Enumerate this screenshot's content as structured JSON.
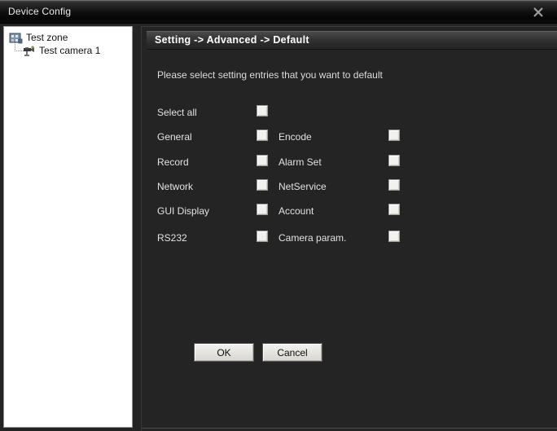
{
  "window": {
    "title": "Device Config",
    "close_icon": "close-x-icon"
  },
  "tree": {
    "nodes": [
      {
        "label": "Test zone",
        "icon": "zone-folder-icon"
      },
      {
        "label": "Test camera 1",
        "icon": "camera-icon"
      }
    ]
  },
  "content": {
    "section_header": "Setting -> Advanced -> Default",
    "instruction": "Please select setting entries that you want to default"
  },
  "rows": [
    {
      "col1_label": "Select all",
      "col1_checked": false,
      "col2_label": "",
      "col2_checked": null
    },
    {
      "col1_label": "General",
      "col1_checked": false,
      "col2_label": "Encode",
      "col2_checked": false
    },
    {
      "col1_label": "Record",
      "col1_checked": false,
      "col2_label": "Alarm Set",
      "col2_checked": false
    },
    {
      "col1_label": "Network",
      "col1_checked": false,
      "col2_label": "NetService",
      "col2_checked": false
    },
    {
      "col1_label": "GUI Display",
      "col1_checked": false,
      "col2_label": "Account",
      "col2_checked": false
    },
    {
      "col1_label": "RS232",
      "col1_checked": false,
      "col2_label": "Camera param.",
      "col2_checked": false
    }
  ],
  "buttons": {
    "ok": "OK",
    "cancel": "Cancel"
  },
  "colors": {
    "titlebar_dark": "#0a0a0a",
    "panel_background": "#242424",
    "tree_background": "#ffffff",
    "text_light": "#e2e2e2",
    "checkbox_fill": "#f2f1ee",
    "button_face": "#e6e4df"
  }
}
